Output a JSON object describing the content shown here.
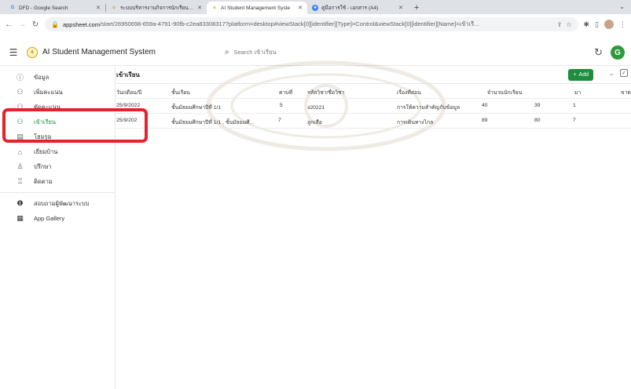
{
  "browser": {
    "tabs": [
      {
        "title": "DFD - Google Search",
        "icon": "google-icon"
      },
      {
        "title": "ระบบบริหารงานกิจการนักเรียน ระ",
        "icon": "appsheet-icon"
      },
      {
        "title": "AI Student Management Syste",
        "icon": "appsheet-icon"
      },
      {
        "title": "คู่มือการใช้ - เอกสาร (A4)",
        "icon": "chrome-icon"
      }
    ],
    "new_tab": "+",
    "url_host": "appsheet.com",
    "url_path": "/start/26950698-659a-4791-90fb-c2ea83308317?platform=desktop#viewStack[0][identifier][Type]=Control&viewStack[0][identifier][Name]=เข้าเรี..."
  },
  "app": {
    "name": "AI Student Management System",
    "search_placeholder": "Search เข้าเรียน",
    "user_initial": "G"
  },
  "sidebar": {
    "items": [
      {
        "label": "ข้อมูล",
        "icon": "info-circle-icon"
      },
      {
        "label": "เพิ่มคะแนน",
        "icon": "person-add-icon"
      },
      {
        "label": "ตัดคะแนน",
        "icon": "person-remove-icon"
      },
      {
        "label": "เข้าเรียน",
        "icon": "person-check-icon",
        "active": true
      },
      {
        "label": "โฮมรูม",
        "icon": "chart-icon"
      },
      {
        "label": "เยี่ยมบ้าน",
        "icon": "home-icon"
      },
      {
        "label": "ปรึกษา",
        "icon": "advisor-icon"
      },
      {
        "label": "ติดตาม",
        "icon": "track-icon"
      }
    ],
    "extra": [
      {
        "label": "สอบถามผู้พัฒนาระบบ",
        "icon": "info-filled-icon"
      },
      {
        "label": "App Gallery",
        "icon": "grid-icon"
      }
    ]
  },
  "view": {
    "title": "เข้าเรียน",
    "add_label": "Add",
    "columns": [
      "วัน/เดือน/ปี",
      "ชั้นเรียน",
      "คาบที่",
      "รหัสวิชา/ชื่อวิชา",
      "เรื่องที่สอน",
      "จำนวนนักเรียน",
      "มา",
      "ขาด"
    ],
    "rows": [
      [
        "25/9/2022",
        "ชั้นมัธยมศึกษาปีที่ 1/1",
        "5",
        "ง20221",
        "การให้ความสำคัญกับข้อมูล",
        "40",
        "39",
        "1"
      ],
      [
        "25/9/202",
        "ชั้นมัธยมศึกษาปีที่ 1/1 , ชั้นมัธยมศึ...",
        "7",
        "ลูกเสือ",
        "การเดินทางไกล",
        "89",
        "80",
        "7"
      ]
    ]
  },
  "colors": {
    "accent": "#1e8e3e",
    "highlight": "#e8212b"
  }
}
